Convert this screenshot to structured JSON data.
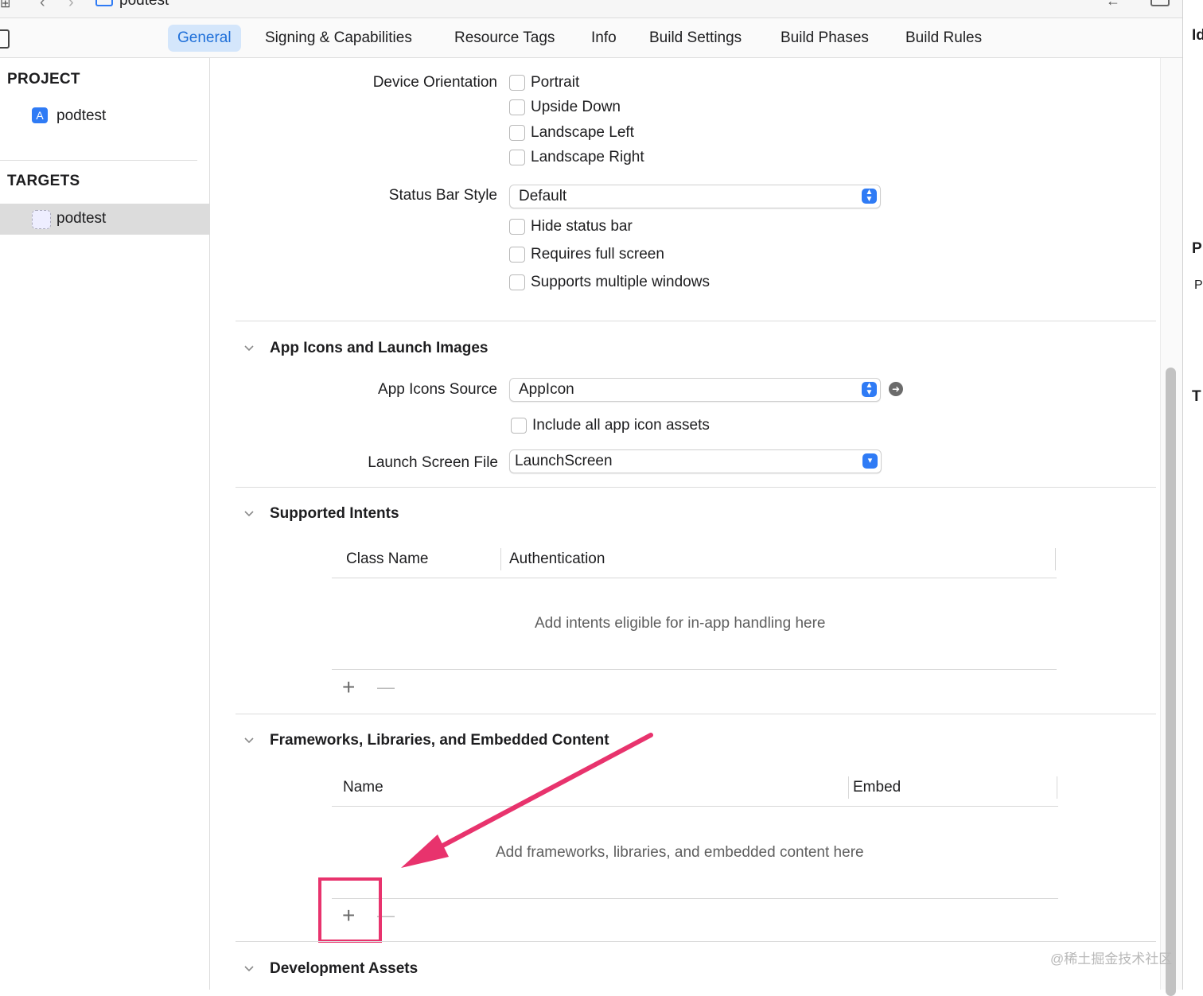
{
  "toolbar": {
    "project_name": "podtest"
  },
  "tabs": [
    {
      "label": "General",
      "selected": true
    },
    {
      "label": "Signing & Capabilities"
    },
    {
      "label": "Resource Tags"
    },
    {
      "label": "Info"
    },
    {
      "label": "Build Settings"
    },
    {
      "label": "Build Phases"
    },
    {
      "label": "Build Rules"
    }
  ],
  "sidebar": {
    "project_header": "PROJECT",
    "project_item": "podtest",
    "targets_header": "TARGETS",
    "target_item": "podtest"
  },
  "deployment": {
    "orientation_label": "Device Orientation",
    "orientations": [
      {
        "label": "Portrait",
        "checked": false
      },
      {
        "label": "Upside Down",
        "checked": false
      },
      {
        "label": "Landscape Left",
        "checked": false
      },
      {
        "label": "Landscape Right",
        "checked": false
      }
    ],
    "status_bar_label": "Status Bar Style",
    "status_bar_value": "Default",
    "status_options": [
      {
        "label": "Hide status bar",
        "checked": false
      },
      {
        "label": "Requires full screen",
        "checked": false
      },
      {
        "label": "Supports multiple windows",
        "checked": false
      }
    ]
  },
  "app_icons": {
    "title": "App Icons and Launch Images",
    "source_label": "App Icons Source",
    "source_value": "AppIcon",
    "include_all_label": "Include all app icon assets",
    "launch_label": "Launch Screen File",
    "launch_value": "LaunchScreen"
  },
  "intents": {
    "title": "Supported Intents",
    "col_class": "Class Name",
    "col_auth": "Authentication",
    "placeholder": "Add intents eligible for in-app handling here",
    "add": "+",
    "remove": "—"
  },
  "frameworks": {
    "title": "Frameworks, Libraries, and Embedded Content",
    "col_name": "Name",
    "col_embed": "Embed",
    "placeholder": "Add frameworks, libraries, and embedded content here",
    "add": "+",
    "remove": "—"
  },
  "dev_assets": {
    "title": "Development Assets"
  },
  "inspector": {
    "letters": [
      "Id",
      "P",
      "P",
      "T"
    ]
  },
  "watermark": "@稀土掘金技术社区",
  "colors": {
    "accent": "#2f7bf5",
    "highlight": "#e8336d",
    "tab_selected_bg": "#d4e6fb"
  }
}
